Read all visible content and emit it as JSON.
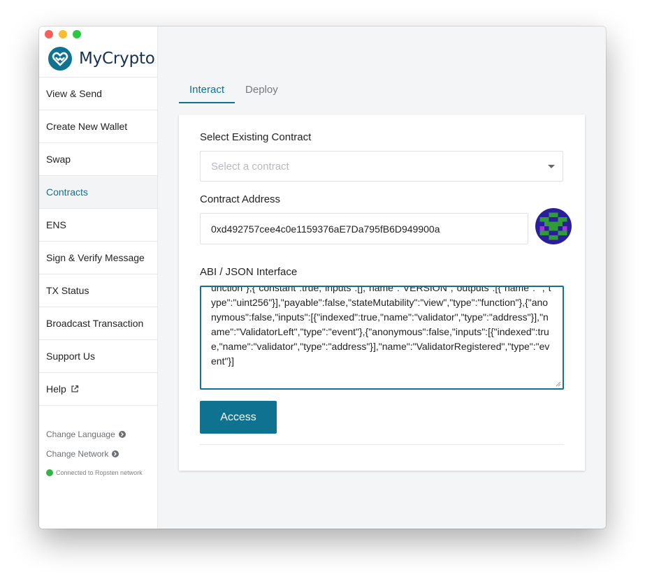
{
  "app": {
    "name": "MyCrypto"
  },
  "colors": {
    "brand": "#0e7290",
    "logo_dark": "#163151",
    "status_ok": "#35b24a"
  },
  "sidebar": {
    "items": [
      {
        "label": "View & Send"
      },
      {
        "label": "Create New Wallet"
      },
      {
        "label": "Swap"
      },
      {
        "label": "Contracts",
        "active": true
      },
      {
        "label": "ENS"
      },
      {
        "label": "Sign & Verify Message"
      },
      {
        "label": "TX Status"
      },
      {
        "label": "Broadcast Transaction"
      },
      {
        "label": "Support Us"
      },
      {
        "label": "Help",
        "icon": "external-link-icon"
      }
    ],
    "change_language": "Change Language",
    "change_network": "Change Network",
    "network_status": "Connected to Ropsten network"
  },
  "tabs": [
    {
      "label": "Interact",
      "active": true
    },
    {
      "label": "Deploy",
      "active": false
    }
  ],
  "form": {
    "select_label": "Select Existing Contract",
    "select_placeholder": "Select a contract",
    "address_label": "Contract Address",
    "address_value": "0xd492757cee4c0e1159376aE7Da795fB6D949900a",
    "abi_label": "ABI / JSON Interface",
    "abi_value": "unction\"},{\"constant\":true,\"inputs\":[],\"name\":\"VERSION\",\"outputs\":[{\"name\":\"\",\"type\":\"uint256\"}],\"payable\":false,\"stateMutability\":\"view\",\"type\":\"function\"},{\"anonymous\":false,\"inputs\":[{\"indexed\":true,\"name\":\"validator\",\"type\":\"address\"}],\"name\":\"ValidatorLeft\",\"type\":\"event\"},{\"anonymous\":false,\"inputs\":[{\"indexed\":true,\"name\":\"validator\",\"type\":\"address\"}],\"name\":\"ValidatorRegistered\",\"type\":\"event\"}]",
    "access_button": "Access"
  }
}
